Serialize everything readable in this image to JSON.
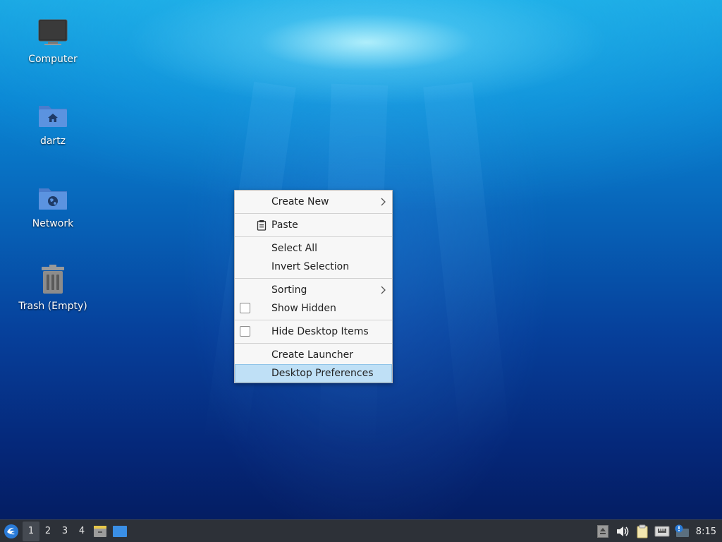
{
  "desktop": {
    "icons": [
      {
        "label": "Computer",
        "icon": "computer-icon"
      },
      {
        "label": "dartz",
        "icon": "home-folder-icon"
      },
      {
        "label": "Network",
        "icon": "network-folder-icon"
      },
      {
        "label": "Trash (Empty)",
        "icon": "trash-icon"
      }
    ]
  },
  "context_menu": {
    "items": {
      "create_new": "Create New",
      "paste": "Paste",
      "select_all": "Select All",
      "invert_selection": "Invert Selection",
      "sorting": "Sorting",
      "show_hidden": "Show Hidden",
      "hide_desktop_items": "Hide Desktop Items",
      "create_launcher": "Create Launcher",
      "desktop_preferences": "Desktop Preferences"
    },
    "highlighted": "Desktop Preferences"
  },
  "taskbar": {
    "workspaces": [
      "1",
      "2",
      "3",
      "4"
    ],
    "active_workspace": "1",
    "clock": "8:15"
  },
  "colors": {
    "menu_highlight": "#bfe0f6",
    "taskbar_bg": "#2d3138"
  }
}
